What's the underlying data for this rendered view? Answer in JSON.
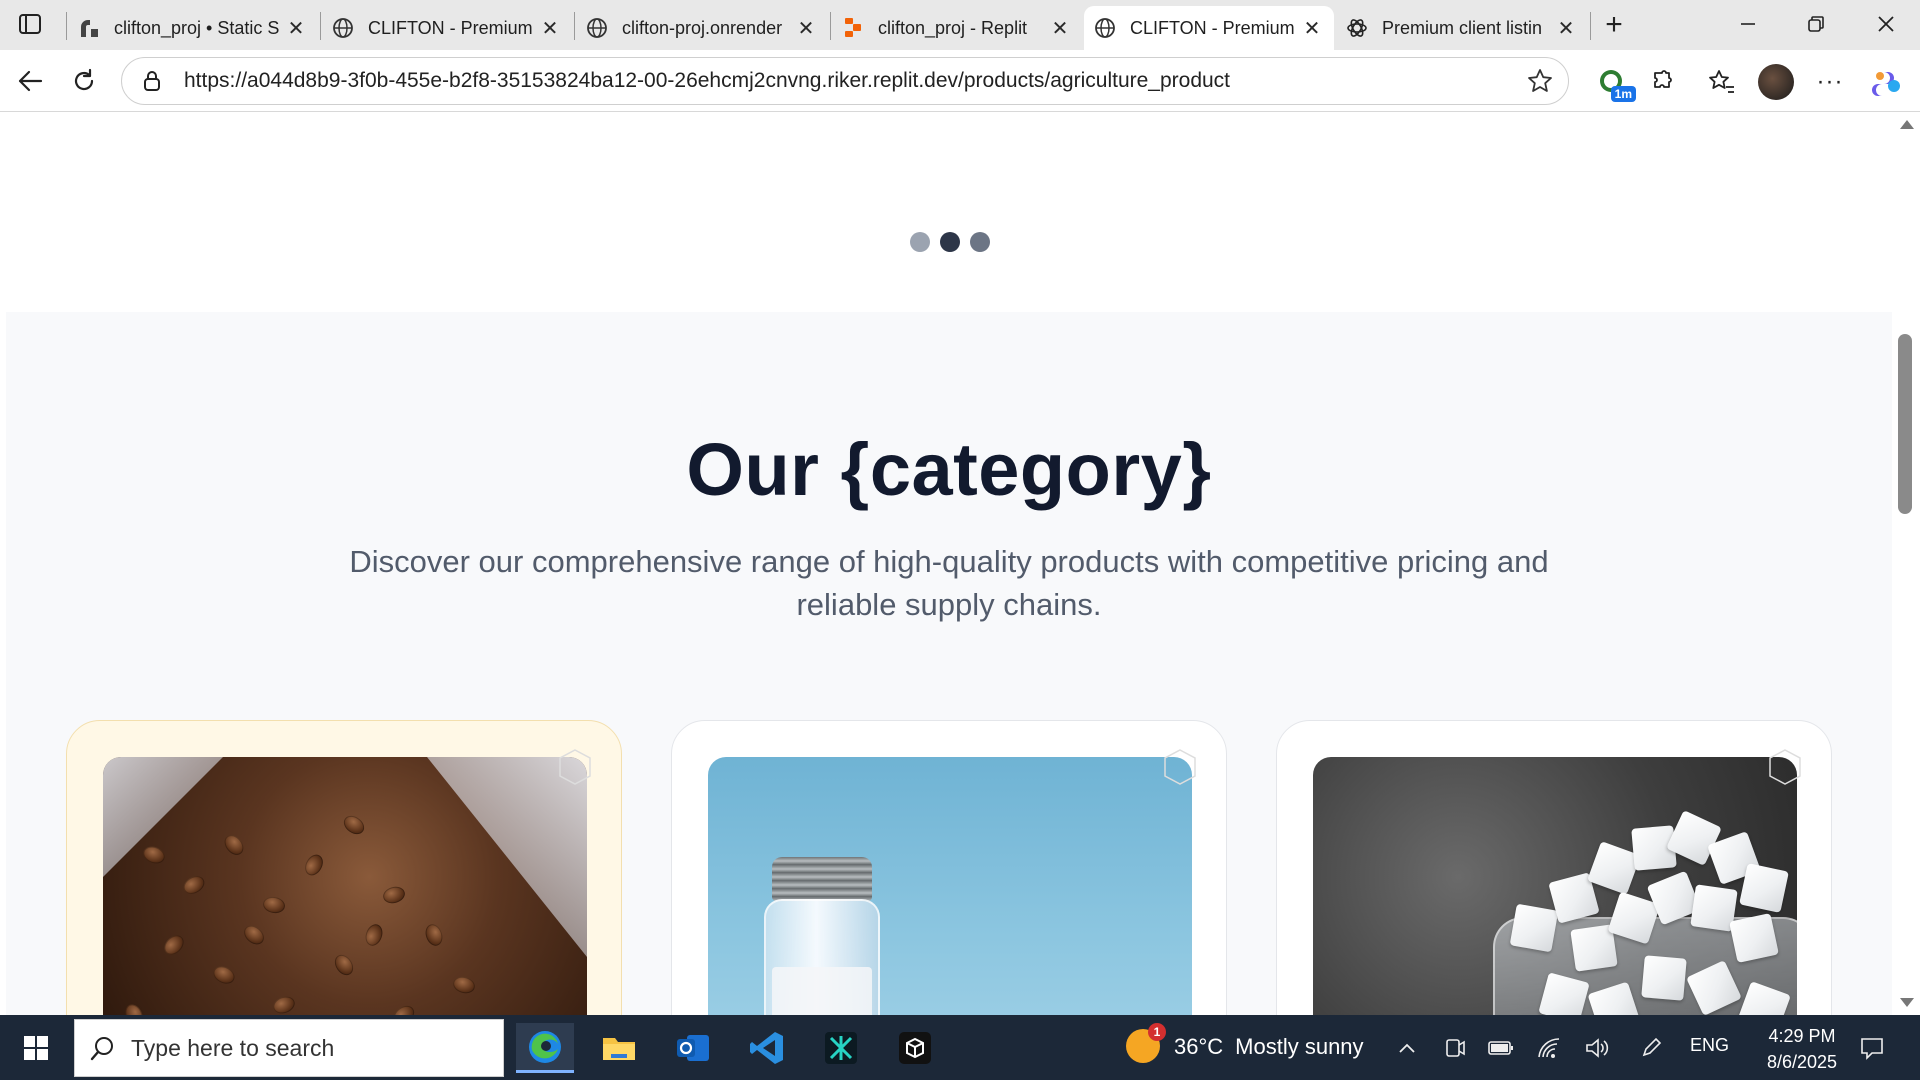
{
  "browser": {
    "tabs": [
      {
        "title": "clifton_proj • Static S",
        "favicon": "render-icon",
        "active": false
      },
      {
        "title": "CLIFTON - Premium",
        "favicon": "globe-icon",
        "active": false
      },
      {
        "title": "clifton-proj.onrender",
        "favicon": "globe-icon",
        "active": false
      },
      {
        "title": "clifton_proj - Replit",
        "favicon": "replit-icon",
        "active": false
      },
      {
        "title": "CLIFTON - Premium",
        "favicon": "globe-icon",
        "active": true
      },
      {
        "title": "Premium client listin",
        "favicon": "chatgpt-icon",
        "active": false
      }
    ],
    "url": "https://a044d8b9-3f0b-455e-b2f8-35153824ba12-00-26ehcmj2cnvng.riker.replit.dev/products/agriculture_product",
    "extension_badge": "1m"
  },
  "page": {
    "carousel": {
      "dot_count": 3,
      "active_index": 1
    },
    "category": {
      "title": "Our {category}",
      "description": "Discover our comprehensive range of high-quality products with competitive pricing and reliable supply chains."
    },
    "products": [
      {
        "image": "coffee-beans",
        "featured": true
      },
      {
        "image": "salt-shaker",
        "featured": false
      },
      {
        "image": "sugar-cubes",
        "featured": false
      }
    ]
  },
  "taskbar": {
    "search_placeholder": "Type here to search",
    "weather": {
      "temp": "36°C",
      "condition": "Mostly sunny",
      "badge": "1"
    },
    "language": "ENG",
    "time": "4:29 PM",
    "date": "8/6/2025"
  },
  "colors": {
    "heading": "#121a2e",
    "body_text": "#525b6b",
    "featured_card_bg": "#fff8e6",
    "taskbar_bg": "#1c2838"
  }
}
